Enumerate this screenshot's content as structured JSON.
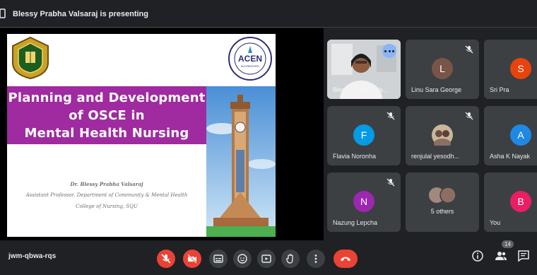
{
  "header": {
    "presenting_text": "Blessy Prabha Valsaraj is presenting"
  },
  "slide": {
    "title_lines": [
      "Planning and Development",
      "of OSCE in",
      "Mental Health Nursing"
    ],
    "presenter_lines": [
      "Dr. Blessy Prabha Valsaraj",
      "Assistant Professor, Department of Community & Mental Health",
      "College of Nursing, SQU"
    ],
    "logo_text": "ACEN",
    "logo_subtext": "ACCREDITED"
  },
  "participants": [
    {
      "name": "Blessy Prabha Va...",
      "type": "video",
      "active": true
    },
    {
      "name": "Linu Sara George",
      "initial": "L",
      "color": "#795548",
      "muted": true
    },
    {
      "name": "Sri Pra",
      "initial": "S",
      "color": "#e8430c",
      "muted": false
    },
    {
      "name": "Flavia Noronha",
      "initial": "F",
      "color": "#039be5",
      "muted": true
    },
    {
      "name": "renjulal yesodh...",
      "type": "photo",
      "muted": true
    },
    {
      "name": "Asha K Nayak",
      "initial": "A",
      "color": "#1e88e5",
      "muted": false
    },
    {
      "name": "Nazung Lepcha",
      "initial": "N",
      "color": "#9c27b0",
      "muted": true
    },
    {
      "name": "5 others",
      "type": "group"
    },
    {
      "name": "You",
      "initial": "B",
      "color": "#e91e63"
    }
  ],
  "bottom": {
    "meeting_code": "jwm-qbwa-rqs",
    "people_count": "14"
  },
  "controls": [
    "mic-off-icon",
    "camera-off-icon",
    "captions-icon",
    "emoji-icon",
    "present-icon",
    "raise-hand-icon",
    "more-options-icon",
    "end-call-icon"
  ],
  "colors": {
    "background": "#202124",
    "tile": "#3c4043",
    "danger": "#ea4335",
    "accent": "#8ab4f8",
    "slide_band": "#a02aa0"
  }
}
